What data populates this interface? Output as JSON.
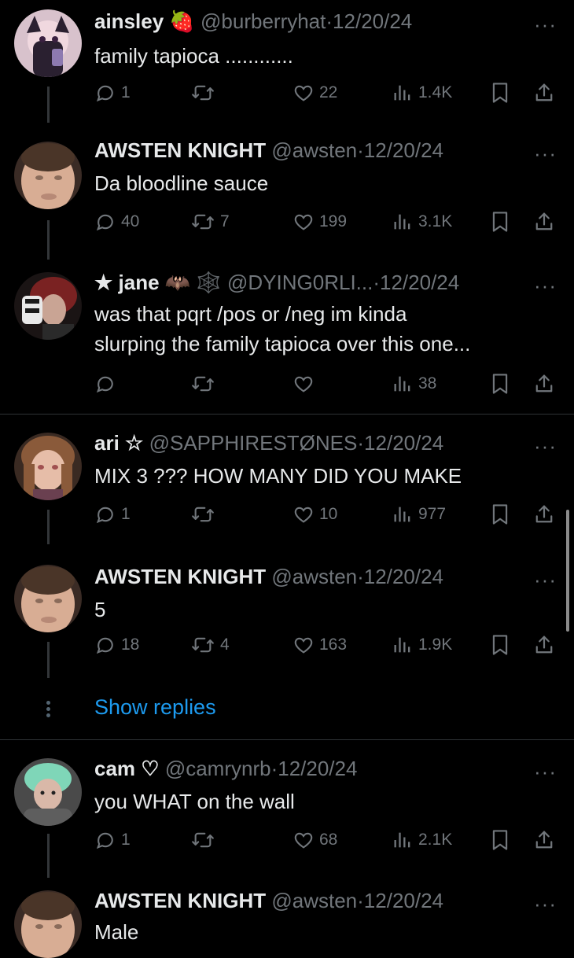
{
  "posts": [
    {
      "name": "ainsley",
      "emoji": "🍓",
      "handle": "@burberryhat",
      "date": "12/20/24",
      "text": [
        "family tapioca ............"
      ],
      "replies": "1",
      "reposts": "",
      "likes": "22",
      "views": "1.4K",
      "avatar_color": "#c9a9b6"
    },
    {
      "name": "AWSTEN KNIGHT",
      "emoji": "",
      "handle": "@awsten",
      "date": "12/20/24",
      "text": [
        "Da bloodline sauce"
      ],
      "replies": "40",
      "reposts": "7",
      "likes": "199",
      "views": "3.1K",
      "avatar_color": "#d9b39d"
    },
    {
      "name": "★ jane",
      "emoji": "🦇 🕸️",
      "handle": "@DYING0RLI...",
      "date": "12/20/24",
      "text": [
        "was that pqrt /pos or /neg im kinda",
        "slurping the family tapioca over this one..."
      ],
      "replies": "",
      "reposts": "",
      "likes": "",
      "views": "38",
      "avatar_color": "#5a2020"
    },
    {
      "name": "ari ☆",
      "emoji": "",
      "handle": "@SAPPHIRESTØNES",
      "date": "12/20/24",
      "text": [
        "MIX 3 ??? HOW MANY DID YOU MAKE"
      ],
      "replies": "1",
      "reposts": "",
      "likes": "10",
      "views": "977",
      "avatar_color": "#b08870"
    },
    {
      "name": "AWSTEN KNIGHT",
      "emoji": "",
      "handle": "@awsten",
      "date": "12/20/24",
      "text": [
        "5"
      ],
      "replies": "18",
      "reposts": "4",
      "likes": "163",
      "views": "1.9K",
      "avatar_color": "#d9b39d"
    },
    {
      "name": "cam ♡",
      "emoji": "",
      "handle": "@camrynrb",
      "date": "12/20/24",
      "text": [
        "you WHAT on the wall"
      ],
      "replies": "1",
      "reposts": "",
      "likes": "68",
      "views": "2.1K",
      "avatar_color": "#6fbfa8"
    },
    {
      "name": "AWSTEN KNIGHT",
      "emoji": "",
      "handle": "@awsten",
      "date": "12/20/24",
      "text": [
        "Male"
      ],
      "replies": "",
      "reposts": "",
      "likes": "",
      "views": "",
      "avatar_color": "#d9b39d"
    }
  ],
  "show_replies_label": "Show replies",
  "more_glyph": "···",
  "colors": {
    "accent": "#1d9bf0",
    "muted": "#71767b",
    "text": "#e7e9ea",
    "background": "#000000"
  }
}
